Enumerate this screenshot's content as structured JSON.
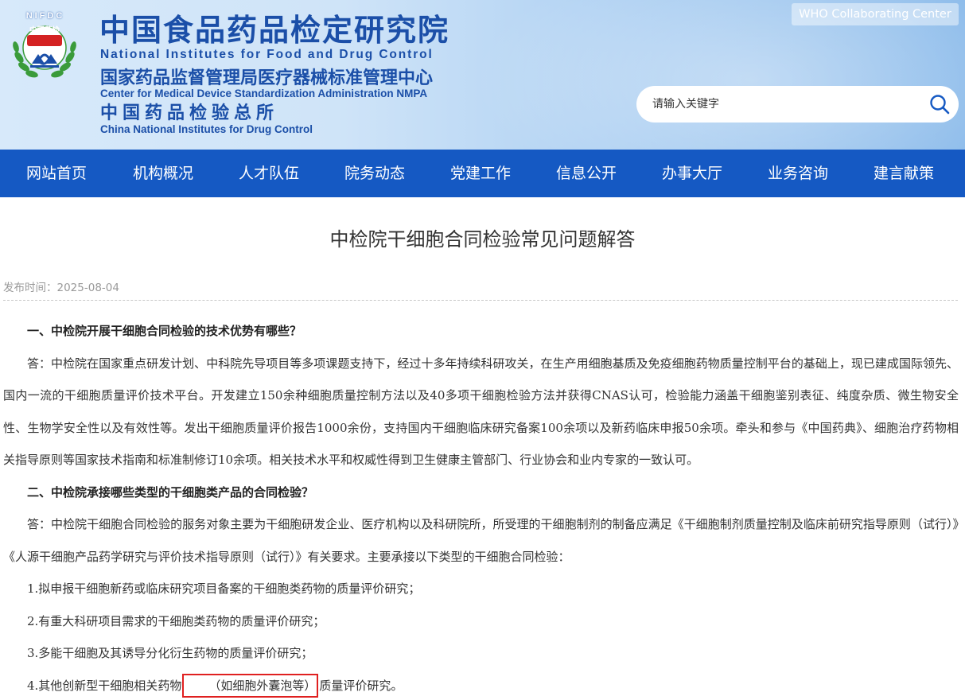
{
  "header": {
    "logo_text_top": "NIFDC",
    "logo_text_badge": "中国药检",
    "cn_title": "中国食品药品检定研究院",
    "en_title": "National Institutes for Food and Drug Control",
    "cn_sub1": "国家药品监督管理局医疗器械标准管理中心",
    "en_sub1": "Center for Medical Device Standardization Administration NMPA",
    "cn_sub2": "中国药品检验总所",
    "en_sub2": "China National Institutes for Drug Control",
    "who_label": "WHO Collaborating Center",
    "search_placeholder": "请输入关键字"
  },
  "nav": {
    "items": [
      {
        "label": "网站首页"
      },
      {
        "label": "机构概况"
      },
      {
        "label": "人才队伍"
      },
      {
        "label": "院务动态"
      },
      {
        "label": "党建工作"
      },
      {
        "label": "信息公开"
      },
      {
        "label": "办事大厅"
      },
      {
        "label": "业务咨询"
      },
      {
        "label": "建言献策"
      }
    ]
  },
  "article": {
    "title": "中检院干细胞合同检验常见问题解答",
    "date_label": "发布时间：",
    "date_value": "2025-08-04",
    "q1": "一、中检院开展干细胞合同检验的技术优势有哪些？",
    "a1": "答：中检院在国家重点研发计划、中科院先导项目等多项课题支持下，经过十多年持续科研攻关，在生产用细胞基质及免疫细胞药物质量控制平台的基础上，现已建成国际领先、国内一流的干细胞质量评价技术平台。开发建立150余种细胞质量控制方法以及40多项干细胞检验方法并获得CNAS认可，检验能力涵盖干细胞鉴别表征、纯度杂质、微生物安全性、生物学安全性以及有效性等。发出干细胞质量评价报告1000余份，支持国内干细胞临床研究备案100余项以及新药临床申报50余项。牵头和参与《中国药典》、细胞治疗药物相关指导原则等国家技术指南和标准制修订10余项。相关技术水平和权威性得到卫生健康主管部门、行业协会和业内专家的一致认可。",
    "q2": "二、中检院承接哪些类型的干细胞类产品的合同检验？",
    "a2": "答：中检院干细胞合同检验的服务对象主要为干细胞研发企业、医疗机构以及科研院所，所受理的干细胞制剂的制备应满足《干细胞制剂质量控制及临床前研究指导原则（试行）》《人源干细胞产品药学研究与评价技术指导原则（试行）》有关要求。主要承接以下类型的干细胞合同检验：",
    "item1": "1.拟申报干细胞新药或临床研究项目备案的干细胞类药物的质量评价研究；",
    "item2": "2.有重大科研项目需求的干细胞类药物的质量评价研究；",
    "item3": "3.多能干细胞及其诱导分化衍生药物的质量评价研究；",
    "item4_pre": "4.其他创新型干细胞相关药物",
    "item4_hl": "（如细胞外囊泡等）",
    "item4_post": "质量评价研究。"
  }
}
